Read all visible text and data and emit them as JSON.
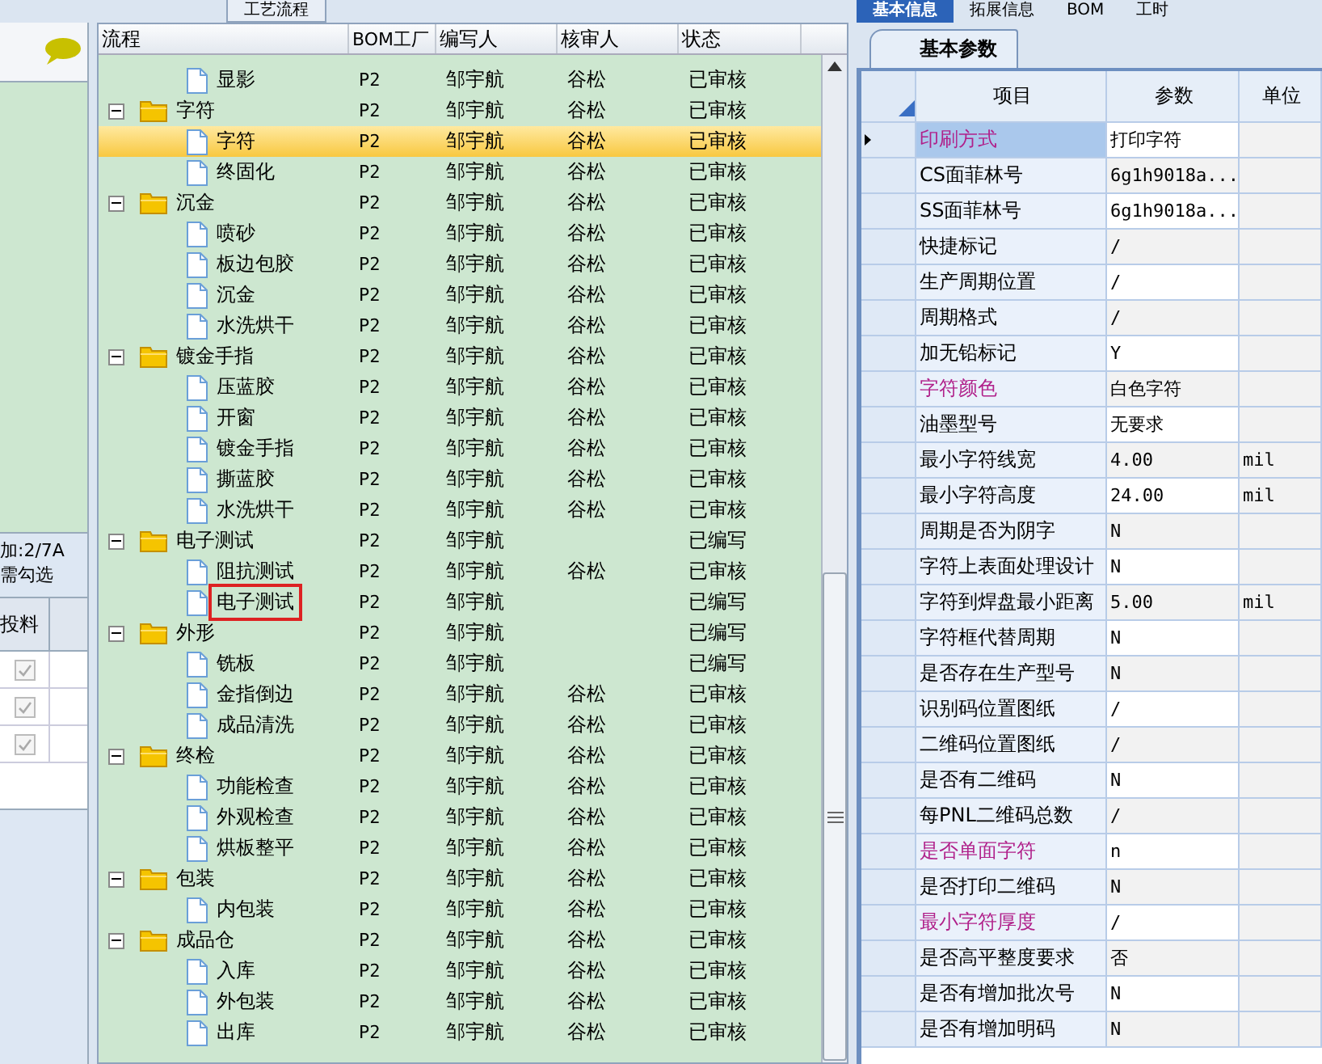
{
  "left_panel": {
    "note_lines": [
      "加:2/7A",
      "需勾选"
    ],
    "column": "投料",
    "rows": [
      {
        "checked": true
      },
      {
        "checked": true
      },
      {
        "checked": true
      }
    ]
  },
  "process_panel": {
    "tab": "工艺流程",
    "columns": [
      "流程",
      "BOM工厂",
      "编写人",
      "核审人",
      "状态"
    ],
    "rows": [
      {
        "kind": "leaf",
        "name": "显影",
        "bom": "P2",
        "writer": "邹宇航",
        "reviewer": "谷松",
        "status": "已审核",
        "selected": false,
        "marked": false
      },
      {
        "kind": "group",
        "name": "字符",
        "bom": "P2",
        "writer": "邹宇航",
        "reviewer": "谷松",
        "status": "已审核",
        "selected": false,
        "marked": false,
        "expanded": true,
        "children": [
          {
            "kind": "leaf",
            "name": "字符",
            "bom": "P2",
            "writer": "邹宇航",
            "reviewer": "谷松",
            "status": "已审核",
            "selected": true,
            "marked": false
          },
          {
            "kind": "leaf",
            "name": "终固化",
            "bom": "P2",
            "writer": "邹宇航",
            "reviewer": "谷松",
            "status": "已审核",
            "selected": false,
            "marked": false
          }
        ]
      },
      {
        "kind": "group",
        "name": "沉金",
        "bom": "P2",
        "writer": "邹宇航",
        "reviewer": "谷松",
        "status": "已审核",
        "selected": false,
        "marked": false,
        "expanded": true,
        "children": [
          {
            "kind": "leaf",
            "name": "喷砂",
            "bom": "P2",
            "writer": "邹宇航",
            "reviewer": "谷松",
            "status": "已审核",
            "selected": false,
            "marked": false
          },
          {
            "kind": "leaf",
            "name": "板边包胶",
            "bom": "P2",
            "writer": "邹宇航",
            "reviewer": "谷松",
            "status": "已审核",
            "selected": false,
            "marked": false
          },
          {
            "kind": "leaf",
            "name": "沉金",
            "bom": "P2",
            "writer": "邹宇航",
            "reviewer": "谷松",
            "status": "已审核",
            "selected": false,
            "marked": false
          },
          {
            "kind": "leaf",
            "name": "水洗烘干",
            "bom": "P2",
            "writer": "邹宇航",
            "reviewer": "谷松",
            "status": "已审核",
            "selected": false,
            "marked": false
          }
        ]
      },
      {
        "kind": "group",
        "name": "镀金手指",
        "bom": "P2",
        "writer": "邹宇航",
        "reviewer": "谷松",
        "status": "已审核",
        "selected": false,
        "marked": false,
        "expanded": true,
        "children": [
          {
            "kind": "leaf",
            "name": "压蓝胶",
            "bom": "P2",
            "writer": "邹宇航",
            "reviewer": "谷松",
            "status": "已审核",
            "selected": false,
            "marked": false
          },
          {
            "kind": "leaf",
            "name": "开窗",
            "bom": "P2",
            "writer": "邹宇航",
            "reviewer": "谷松",
            "status": "已审核",
            "selected": false,
            "marked": false
          },
          {
            "kind": "leaf",
            "name": "镀金手指",
            "bom": "P2",
            "writer": "邹宇航",
            "reviewer": "谷松",
            "status": "已审核",
            "selected": false,
            "marked": false
          },
          {
            "kind": "leaf",
            "name": "撕蓝胶",
            "bom": "P2",
            "writer": "邹宇航",
            "reviewer": "谷松",
            "status": "已审核",
            "selected": false,
            "marked": false
          },
          {
            "kind": "leaf",
            "name": "水洗烘干",
            "bom": "P2",
            "writer": "邹宇航",
            "reviewer": "谷松",
            "status": "已审核",
            "selected": false,
            "marked": false
          }
        ]
      },
      {
        "kind": "group",
        "name": "电子测试",
        "bom": "P2",
        "writer": "邹宇航",
        "status": "已编写",
        "selected": false,
        "marked": false,
        "expanded": true,
        "children": [
          {
            "kind": "leaf",
            "name": "阻抗测试",
            "bom": "P2",
            "writer": "邹宇航",
            "reviewer": "谷松",
            "status": "已审核",
            "selected": false,
            "marked": false
          },
          {
            "kind": "leaf",
            "name": "电子测试",
            "bom": "P2",
            "writer": "邹宇航",
            "status": "已编写",
            "selected": false,
            "marked": true
          }
        ]
      },
      {
        "kind": "group",
        "name": "外形",
        "bom": "P2",
        "writer": "邹宇航",
        "status": "已编写",
        "selected": false,
        "marked": false,
        "expanded": true,
        "children": [
          {
            "kind": "leaf",
            "name": "铣板",
            "bom": "P2",
            "writer": "邹宇航",
            "status": "已编写",
            "selected": false,
            "marked": false
          },
          {
            "kind": "leaf",
            "name": "金指倒边",
            "bom": "P2",
            "writer": "邹宇航",
            "reviewer": "谷松",
            "status": "已审核",
            "selected": false,
            "marked": false
          },
          {
            "kind": "leaf",
            "name": "成品清洗",
            "bom": "P2",
            "writer": "邹宇航",
            "reviewer": "谷松",
            "status": "已审核",
            "selected": false,
            "marked": false
          }
        ]
      },
      {
        "kind": "group",
        "name": "终检",
        "bom": "P2",
        "writer": "邹宇航",
        "reviewer": "谷松",
        "status": "已审核",
        "selected": false,
        "marked": false,
        "expanded": true,
        "children": [
          {
            "kind": "leaf",
            "name": "功能检查",
            "bom": "P2",
            "writer": "邹宇航",
            "reviewer": "谷松",
            "status": "已审核",
            "selected": false,
            "marked": false
          },
          {
            "kind": "leaf",
            "name": "外观检查",
            "bom": "P2",
            "writer": "邹宇航",
            "reviewer": "谷松",
            "status": "已审核",
            "selected": false,
            "marked": false
          },
          {
            "kind": "leaf",
            "name": "烘板整平",
            "bom": "P2",
            "writer": "邹宇航",
            "reviewer": "谷松",
            "status": "已审核",
            "selected": false,
            "marked": false
          }
        ]
      },
      {
        "kind": "group",
        "name": "包装",
        "bom": "P2",
        "writer": "邹宇航",
        "reviewer": "谷松",
        "status": "已审核",
        "selected": false,
        "marked": false,
        "expanded": true,
        "children": [
          {
            "kind": "leaf",
            "name": "内包装",
            "bom": "P2",
            "writer": "邹宇航",
            "reviewer": "谷松",
            "status": "已审核",
            "selected": false,
            "marked": false
          }
        ]
      },
      {
        "kind": "group",
        "name": "成品仓",
        "bom": "P2",
        "writer": "邹宇航",
        "reviewer": "谷松",
        "status": "已审核",
        "selected": false,
        "marked": false,
        "expanded": true,
        "children": [
          {
            "kind": "leaf",
            "name": "入库",
            "bom": "P2",
            "writer": "邹宇航",
            "reviewer": "谷松",
            "status": "已审核",
            "selected": false,
            "marked": false
          },
          {
            "kind": "leaf",
            "name": "外包装",
            "bom": "P2",
            "writer": "邹宇航",
            "reviewer": "谷松",
            "status": "已审核",
            "selected": false,
            "marked": false
          },
          {
            "kind": "leaf",
            "name": "出库",
            "bom": "P2",
            "writer": "邹宇航",
            "reviewer": "谷松",
            "status": "已审核",
            "selected": false,
            "marked": false
          }
        ]
      }
    ]
  },
  "detail_panel": {
    "tabs": [
      {
        "label": "基本信息",
        "selected": true
      },
      {
        "label": "拓展信息",
        "selected": false
      },
      {
        "label": "BOM",
        "selected": false
      },
      {
        "label": "工时",
        "selected": false
      }
    ],
    "subtab": "基本参数",
    "columns": [
      "项目",
      "参数",
      "单位"
    ],
    "rows": [
      {
        "item": "印刷方式",
        "value": "打印字符",
        "emphasis": true,
        "selected": true
      },
      {
        "item": "CS面菲林号",
        "value": "6g1h9018a...",
        "emphasis": false,
        "selected": false
      },
      {
        "item": "SS面菲林号",
        "value": "6g1h9018a...",
        "emphasis": false,
        "selected": false
      },
      {
        "item": "快捷标记",
        "value": "/",
        "emphasis": false,
        "selected": false
      },
      {
        "item": "生产周期位置",
        "value": "/",
        "emphasis": false,
        "selected": false
      },
      {
        "item": "周期格式",
        "value": "/",
        "emphasis": false,
        "selected": false
      },
      {
        "item": "加无铅标记",
        "value": "Y",
        "emphasis": false,
        "selected": false
      },
      {
        "item": "字符颜色",
        "value": "白色字符",
        "emphasis": true,
        "selected": false
      },
      {
        "item": "油墨型号",
        "value": "无要求",
        "emphasis": false,
        "selected": false
      },
      {
        "item": "最小字符线宽",
        "value": "4.00",
        "unit": "mil",
        "emphasis": false,
        "selected": false
      },
      {
        "item": "最小字符高度",
        "value": "24.00",
        "unit": "mil",
        "emphasis": false,
        "selected": false
      },
      {
        "item": "周期是否为阴字",
        "value": "N",
        "emphasis": false,
        "selected": false
      },
      {
        "item": "字符上表面处理设计",
        "value": "N",
        "emphasis": false,
        "selected": false
      },
      {
        "item": "字符到焊盘最小距离",
        "value": "5.00",
        "unit": "mil",
        "emphasis": false,
        "selected": false
      },
      {
        "item": "字符框代替周期",
        "value": "N",
        "emphasis": false,
        "selected": false
      },
      {
        "item": "是否存在生产型号",
        "value": "N",
        "emphasis": false,
        "selected": false
      },
      {
        "item": "识别码位置图纸",
        "value": "/",
        "emphasis": false,
        "selected": false
      },
      {
        "item": "二维码位置图纸",
        "value": "/",
        "emphasis": false,
        "selected": false
      },
      {
        "item": "是否有二维码",
        "value": "N",
        "emphasis": false,
        "selected": false
      },
      {
        "item": "每PNL二维码总数",
        "value": "/",
        "emphasis": false,
        "selected": false
      },
      {
        "item": "是否单面字符",
        "value": "n",
        "emphasis": true,
        "selected": false
      },
      {
        "item": "是否打印二维码",
        "value": "N",
        "emphasis": false,
        "selected": false
      },
      {
        "item": "最小字符厚度",
        "value": "/",
        "emphasis": true,
        "selected": false
      },
      {
        "item": "是否高平整度要求",
        "value": "否",
        "emphasis": false,
        "selected": false
      },
      {
        "item": "是否有增加批次号",
        "value": "N",
        "emphasis": false,
        "selected": false
      },
      {
        "item": "是否有增加明码",
        "value": "N",
        "emphasis": false,
        "selected": false
      }
    ]
  }
}
